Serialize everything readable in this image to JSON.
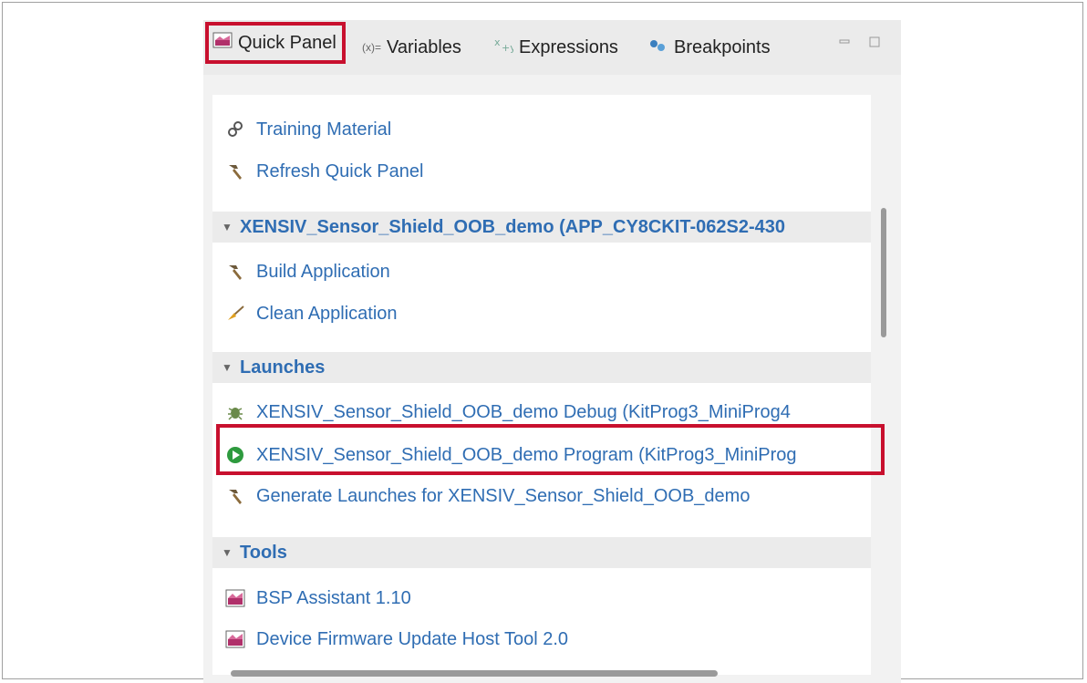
{
  "tabs": {
    "quick_panel": "Quick Panel",
    "variables": "Variables",
    "expressions": "Expressions",
    "breakpoints": "Breakpoints",
    "variables_icon": "(x)="
  },
  "top_items": [
    {
      "label": "Training Material",
      "icon": "link-icon"
    },
    {
      "label": "Refresh Quick Panel",
      "icon": "hammer-icon"
    }
  ],
  "project_section": {
    "title": "XENSIV_Sensor_Shield_OOB_demo (APP_CY8CKIT-062S2-430",
    "items": [
      {
        "label": "Build Application",
        "icon": "hammer-icon"
      },
      {
        "label": "Clean Application",
        "icon": "broom-icon"
      }
    ]
  },
  "launches_section": {
    "title": "Launches",
    "items": [
      {
        "label": "XENSIV_Sensor_Shield_OOB_demo Debug (KitProg3_MiniProg4",
        "icon": "bug-icon"
      },
      {
        "label": "XENSIV_Sensor_Shield_OOB_demo Program (KitProg3_MiniProg",
        "icon": "run-icon"
      },
      {
        "label": "Generate Launches for XENSIV_Sensor_Shield_OOB_demo",
        "icon": "hammer-icon"
      }
    ]
  },
  "tools_section": {
    "title": "Tools",
    "items": [
      {
        "label": "BSP Assistant 1.10",
        "icon": "tool-icon"
      },
      {
        "label": "Device Firmware Update Host Tool 2.0",
        "icon": "tool-icon"
      }
    ]
  },
  "colors": {
    "link": "#2f6db3",
    "highlight": "#c8102e",
    "section_bg": "#ebebeb"
  }
}
